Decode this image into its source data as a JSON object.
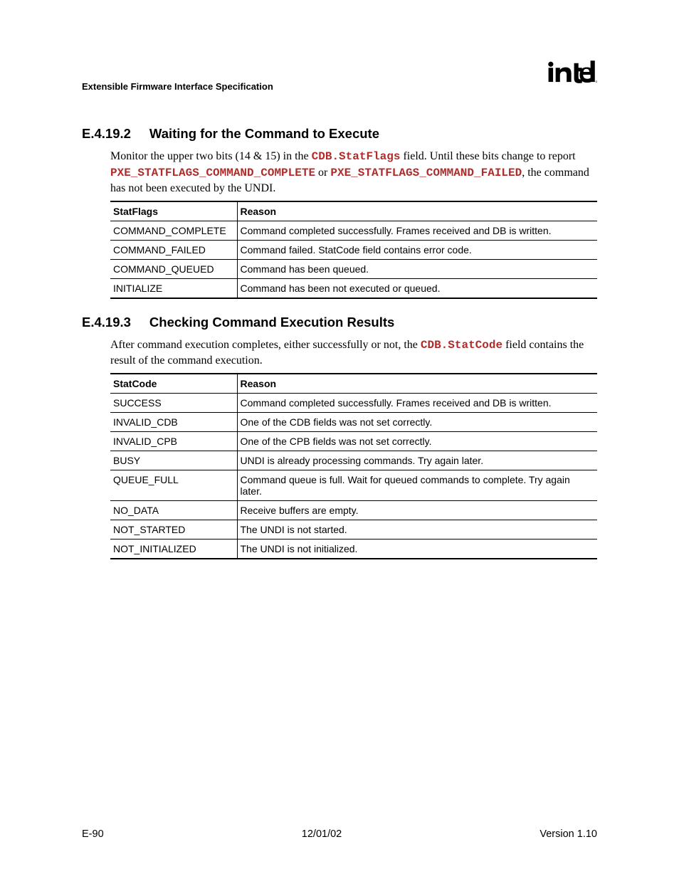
{
  "header": {
    "title": "Extensible Firmware Interface Specification"
  },
  "section1": {
    "number": "E.4.19.2",
    "title": "Waiting for the Command to Execute",
    "para_pre1": "Monitor the upper two bits (14 & 15) in the ",
    "code1": "CDB.StatFlags",
    "para_mid1": " field.  Until these bits change to report ",
    "code2": "PXE_STATFLAGS_COMMAND_COMPLETE",
    "para_mid2": " or ",
    "code3": "PXE_STATFLAGS_COMMAND_FAILED",
    "para_post1": ", the command has not been executed by the UNDI.",
    "table": {
      "h1": "StatFlags",
      "h2": "Reason",
      "rows": [
        {
          "c1": "COMMAND_COMPLETE",
          "c2": "Command completed successfully.  Frames received and DB is written."
        },
        {
          "c1": "COMMAND_FAILED",
          "c2": "Command failed.  StatCode field contains error code."
        },
        {
          "c1": "COMMAND_QUEUED",
          "c2": "Command has been queued."
        },
        {
          "c1": "INITIALIZE",
          "c2": "Command has been not executed or queued."
        }
      ]
    }
  },
  "section2": {
    "number": "E.4.19.3",
    "title": "Checking Command Execution Results",
    "para_pre1": "After command execution completes, either successfully or not, the ",
    "code1": "CDB.StatCode",
    "para_post1": " field contains the result of the command execution.",
    "table": {
      "h1": "StatCode",
      "h2": "Reason",
      "rows": [
        {
          "c1": "SUCCESS",
          "c2": "Command completed successfully.  Frames received and DB is written."
        },
        {
          "c1": "INVALID_CDB",
          "c2": "One of the CDB fields was not set correctly."
        },
        {
          "c1": "INVALID_CPB",
          "c2": "One of the CPB fields was not set correctly."
        },
        {
          "c1": "BUSY",
          "c2": "UNDI is already processing commands.  Try again later."
        },
        {
          "c1": "QUEUE_FULL",
          "c2": "Command queue is full.  Wait for queued commands to complete.  Try again later."
        },
        {
          "c1": "NO_DATA",
          "c2": "Receive buffers are empty."
        },
        {
          "c1": "NOT_STARTED",
          "c2": "The UNDI is not started."
        },
        {
          "c1": "NOT_INITIALIZED",
          "c2": "The UNDI is not initialized."
        }
      ]
    }
  },
  "footer": {
    "left": "E-90",
    "center": "12/01/02",
    "right": "Version 1.10"
  }
}
